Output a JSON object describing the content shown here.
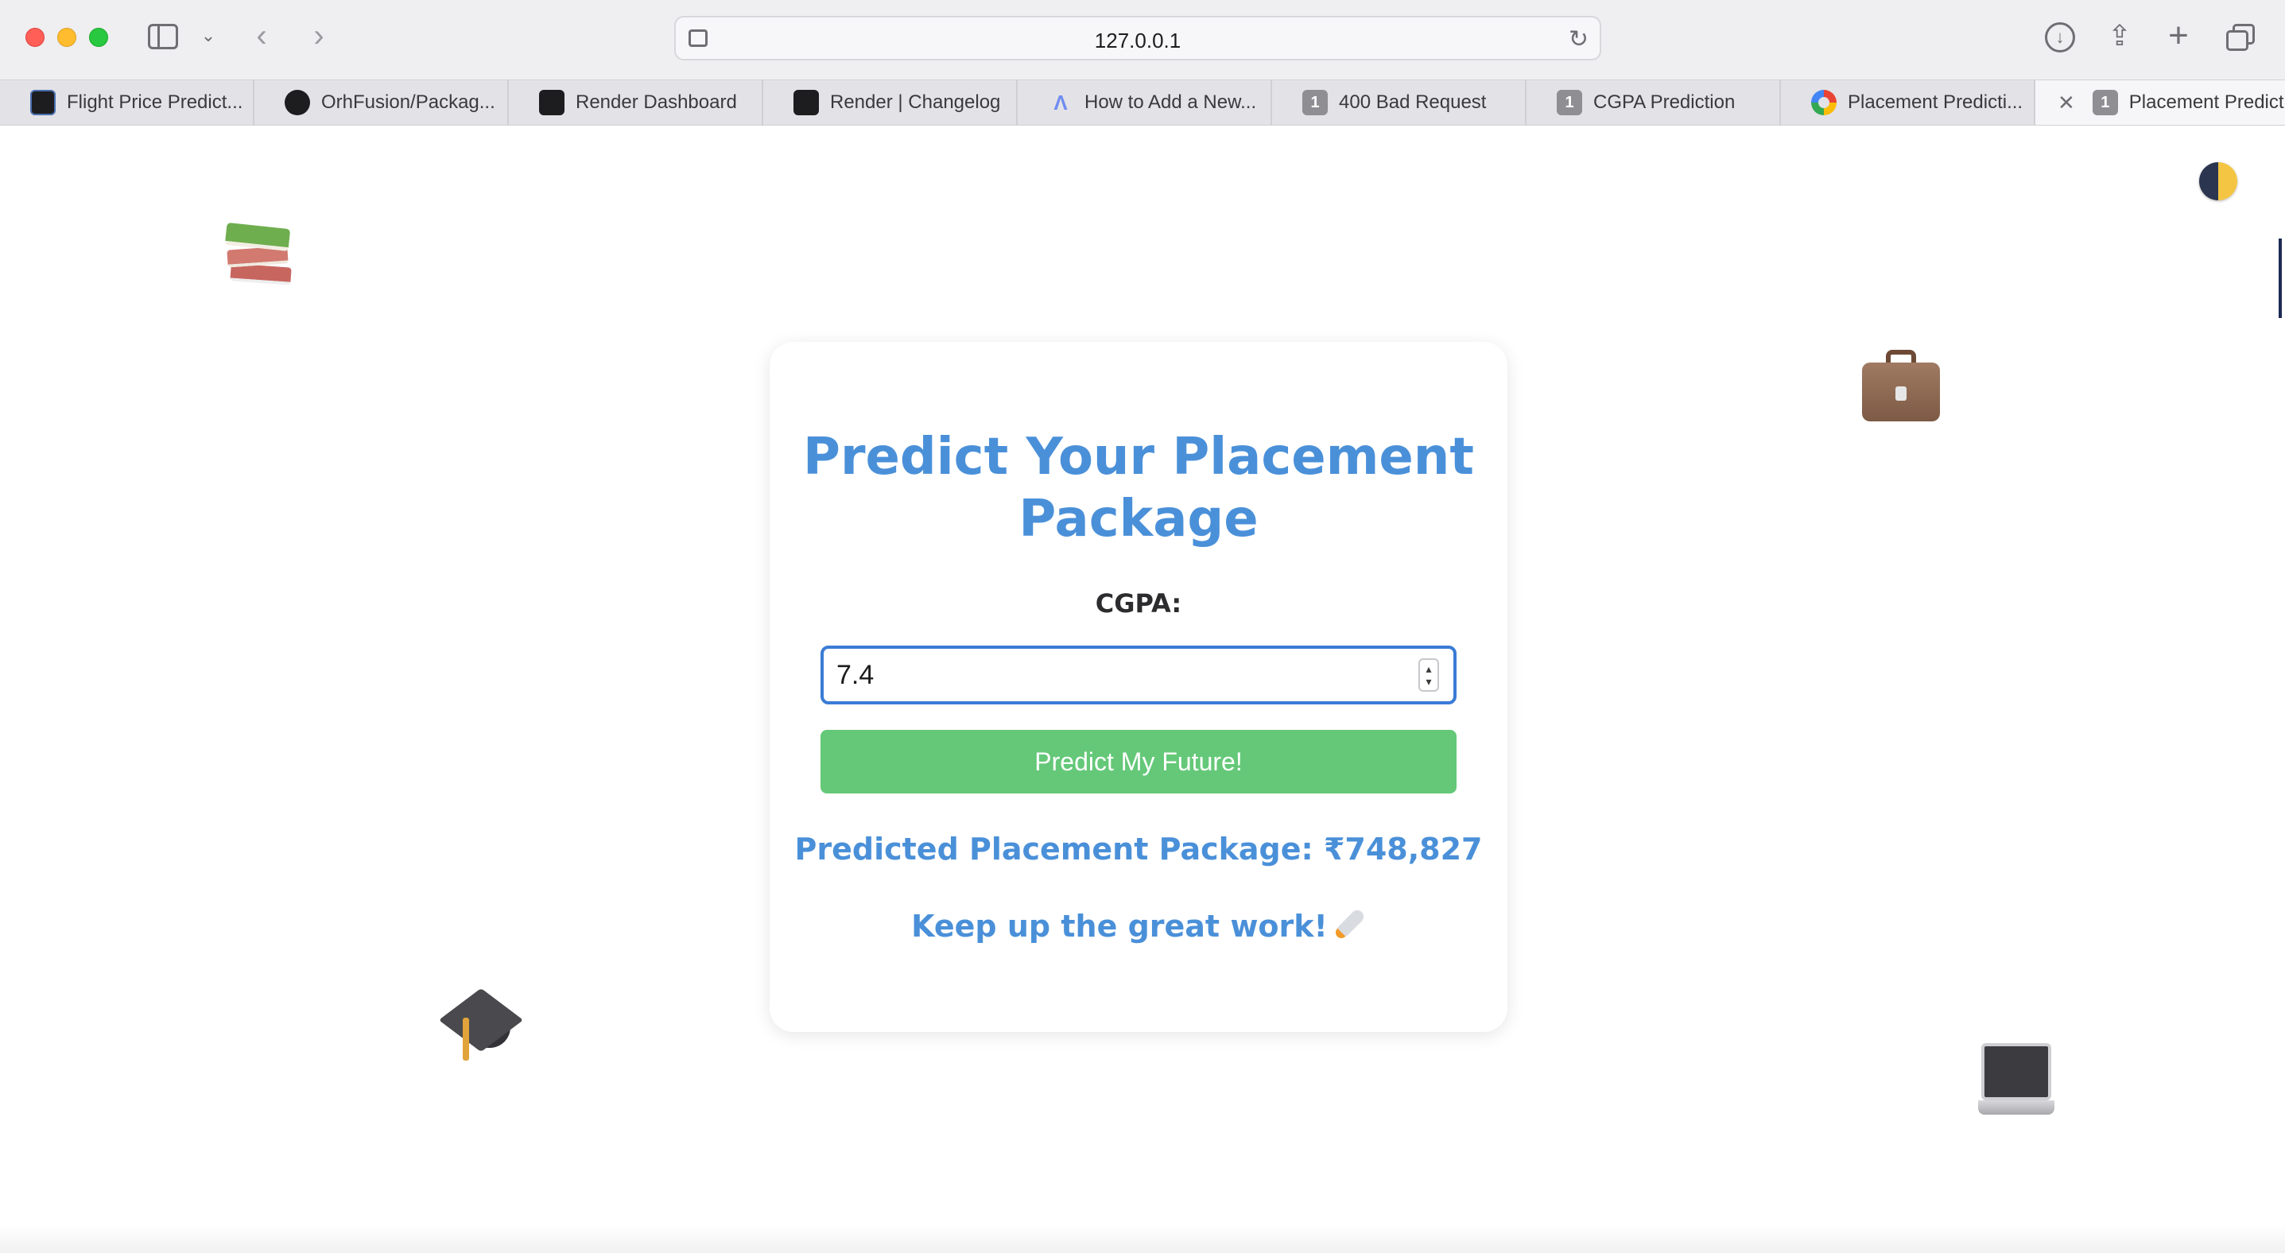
{
  "browser": {
    "url": "127.0.0.1",
    "tabs": [
      {
        "label": "Flight Price Predict...",
        "icon": "terminal-icon"
      },
      {
        "label": "OrhFusion/Packag...",
        "icon": "github-icon"
      },
      {
        "label": "Render Dashboard",
        "icon": "render-icon"
      },
      {
        "label": "Render | Changelog",
        "icon": "render-icon"
      },
      {
        "label": "How to Add a New...",
        "icon": "triangle-logo-icon"
      },
      {
        "label": "400 Bad Request",
        "icon": "number-badge-icon",
        "badge": "1"
      },
      {
        "label": "CGPA Prediction",
        "icon": "number-badge-icon",
        "badge": "1"
      },
      {
        "label": "Placement Predicti...",
        "icon": "color-ring-icon"
      },
      {
        "label": "Placement Predicti...",
        "icon": "number-badge-icon",
        "badge": "1",
        "active": true
      }
    ]
  },
  "page": {
    "title": "Predict Your Placement Package",
    "cgpa_label": "CGPA:",
    "cgpa_value": "7.4",
    "predict_button": "Predict My Future!",
    "result": "Predicted Placement Package: ₹748,827",
    "motivation": "Keep up the great work!",
    "decorations": [
      "books-icon",
      "briefcase-icon",
      "graduation-cap-icon",
      "laptop-icon",
      "rocket-icon"
    ]
  },
  "colors": {
    "accent_blue": "#4a90d9",
    "button_green": "#64c878",
    "input_border": "#3a7bd5"
  }
}
